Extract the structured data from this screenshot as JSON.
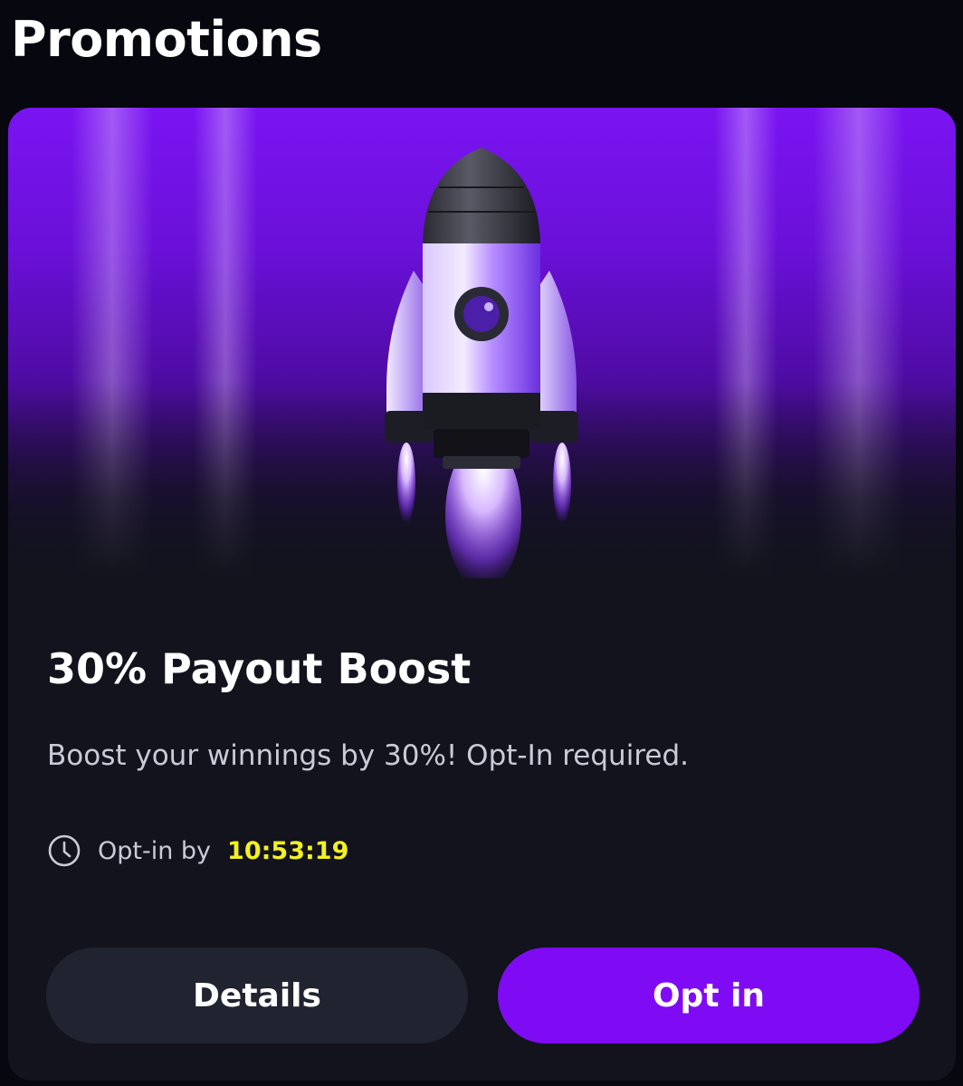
{
  "header": {
    "title": "Promotions"
  },
  "promo": {
    "banner_icon": "rocket-illustration",
    "title": "30% Payout Boost",
    "description": "Boost your winnings by 30%! Opt-In required.",
    "deadline_icon": "clock-icon",
    "deadline_label": "Opt-in by",
    "countdown": "10:53:19",
    "details_label": "Details",
    "optin_label": "Opt in"
  },
  "colors": {
    "background": "#07070f",
    "card": "#12131d",
    "accent": "#7f0bf5",
    "countdown": "#f2f022",
    "secondary_button": "#202330"
  }
}
